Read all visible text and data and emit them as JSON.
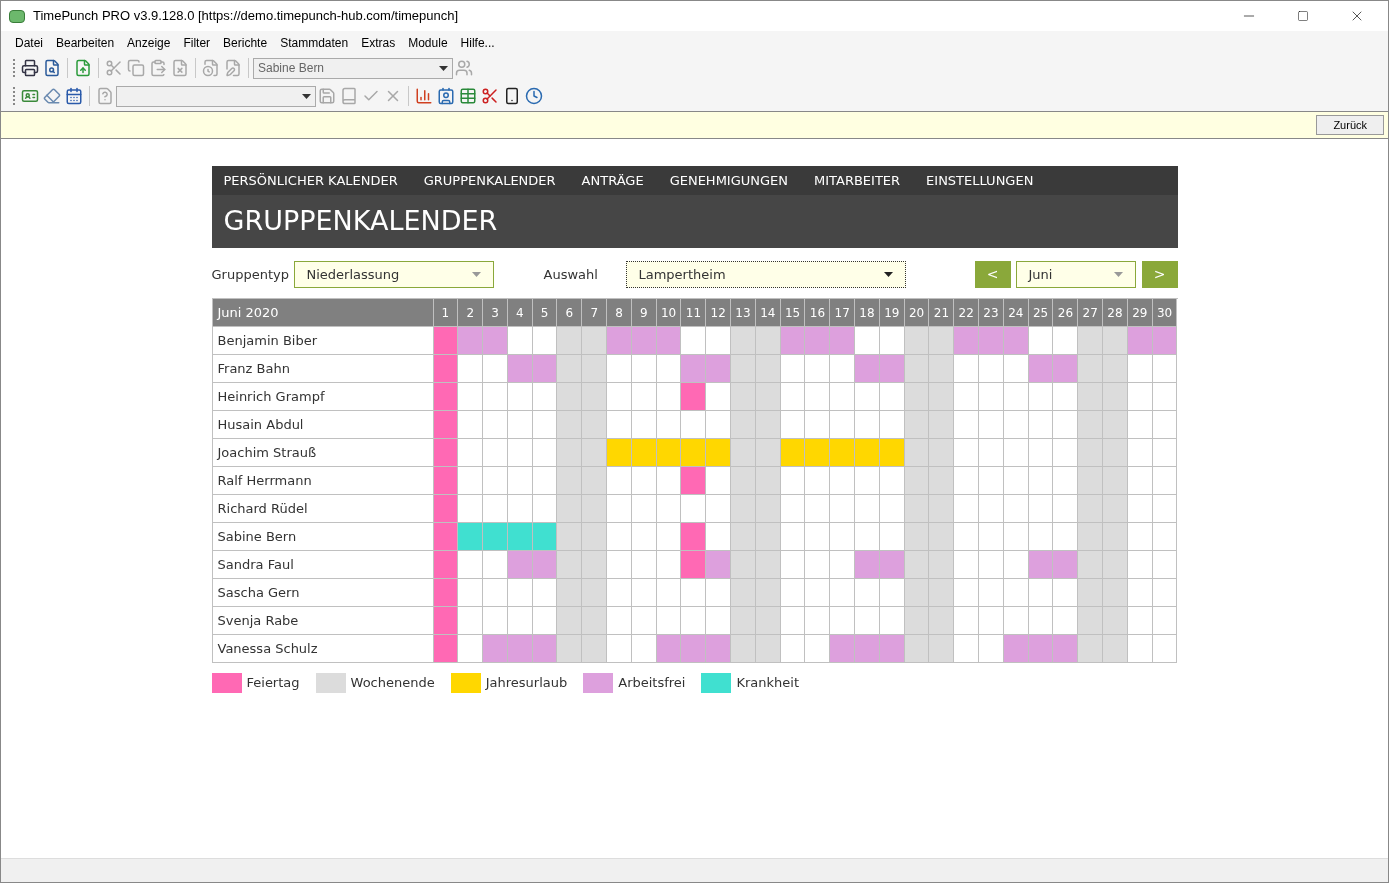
{
  "window": {
    "title": "TimePunch PRO v3.9.128.0 [https://demo.timepunch-hub.com/timepunch]"
  },
  "menu": [
    "Datei",
    "Bearbeiten",
    "Anzeige",
    "Filter",
    "Berichte",
    "Stammdaten",
    "Extras",
    "Module",
    "Hilfe..."
  ],
  "toolbar": {
    "user_select": "Sabine Bern"
  },
  "info_bar": {
    "back_button": "Zurück"
  },
  "nav": [
    "PERSÖNLICHER KALENDER",
    "GRUPPENKALENDER",
    "ANTRÄGE",
    "GENEHMIGUNGEN",
    "MITARBEITER",
    "EINSTELLUNGEN"
  ],
  "page_title": "GRUPPENKALENDER",
  "filters": {
    "group_type_label": "Gruppentyp",
    "group_type": "Niederlassung",
    "selection_label": "Auswahl",
    "selection": "Lampertheim",
    "prev": "<",
    "month": "Juni",
    "next": ">"
  },
  "calendar": {
    "month_label": "Juni 2020",
    "days": [
      "1",
      "2",
      "3",
      "4",
      "5",
      "6",
      "7",
      "8",
      "9",
      "10",
      "11",
      "12",
      "13",
      "14",
      "15",
      "16",
      "17",
      "18",
      "19",
      "20",
      "21",
      "22",
      "23",
      "24",
      "25",
      "26",
      "27",
      "28",
      "29",
      "30"
    ],
    "rows": [
      {
        "name": "Benjamin Biber",
        "cells": [
          {
            "kind": "holiday"
          },
          {
            "kind": "dayoff"
          },
          {
            "kind": "dayoff"
          },
          {
            "kind": "none"
          },
          {
            "kind": "none"
          },
          {
            "kind": "weekend"
          },
          {
            "kind": "weekend"
          },
          {
            "kind": "dayoff"
          },
          {
            "kind": "dayoff"
          },
          {
            "kind": "dayoff"
          },
          {
            "kind": "none"
          },
          {
            "kind": "none"
          },
          {
            "kind": "weekend"
          },
          {
            "kind": "weekend"
          },
          {
            "kind": "dayoff"
          },
          {
            "kind": "dayoff"
          },
          {
            "kind": "dayoff"
          },
          {
            "kind": "none"
          },
          {
            "kind": "none"
          },
          {
            "kind": "weekend"
          },
          {
            "kind": "weekend"
          },
          {
            "kind": "dayoff"
          },
          {
            "kind": "dayoff"
          },
          {
            "kind": "dayoff"
          },
          {
            "kind": "none"
          },
          {
            "kind": "none"
          },
          {
            "kind": "weekend"
          },
          {
            "kind": "weekend"
          },
          {
            "kind": "dayoff"
          },
          {
            "kind": "dayoff"
          }
        ]
      },
      {
        "name": "Franz Bahn",
        "cells": [
          {
            "kind": "holiday"
          },
          {
            "kind": "none"
          },
          {
            "kind": "none"
          },
          {
            "kind": "dayoff"
          },
          {
            "kind": "dayoff"
          },
          {
            "kind": "weekend"
          },
          {
            "kind": "weekend"
          },
          {
            "kind": "none"
          },
          {
            "kind": "none"
          },
          {
            "kind": "none"
          },
          {
            "kind": "dayoff"
          },
          {
            "kind": "dayoff"
          },
          {
            "kind": "weekend"
          },
          {
            "kind": "weekend"
          },
          {
            "kind": "none"
          },
          {
            "kind": "none"
          },
          {
            "kind": "none"
          },
          {
            "kind": "dayoff"
          },
          {
            "kind": "dayoff"
          },
          {
            "kind": "weekend"
          },
          {
            "kind": "weekend"
          },
          {
            "kind": "none"
          },
          {
            "kind": "none"
          },
          {
            "kind": "none"
          },
          {
            "kind": "dayoff"
          },
          {
            "kind": "dayoff"
          },
          {
            "kind": "weekend"
          },
          {
            "kind": "weekend"
          },
          {
            "kind": "none"
          },
          {
            "kind": "none"
          }
        ]
      },
      {
        "name": "Heinrich Grampf",
        "cells": [
          {
            "kind": "holiday"
          },
          {
            "kind": "none"
          },
          {
            "kind": "none"
          },
          {
            "kind": "none"
          },
          {
            "kind": "none"
          },
          {
            "kind": "weekend"
          },
          {
            "kind": "weekend"
          },
          {
            "kind": "none"
          },
          {
            "kind": "none"
          },
          {
            "kind": "none"
          },
          {
            "kind": "holiday"
          },
          {
            "kind": "none"
          },
          {
            "kind": "weekend"
          },
          {
            "kind": "weekend"
          },
          {
            "kind": "none"
          },
          {
            "kind": "none"
          },
          {
            "kind": "none"
          },
          {
            "kind": "none"
          },
          {
            "kind": "none"
          },
          {
            "kind": "weekend"
          },
          {
            "kind": "weekend"
          },
          {
            "kind": "none"
          },
          {
            "kind": "none"
          },
          {
            "kind": "none"
          },
          {
            "kind": "none"
          },
          {
            "kind": "none"
          },
          {
            "kind": "weekend"
          },
          {
            "kind": "weekend"
          },
          {
            "kind": "none"
          },
          {
            "kind": "none"
          }
        ]
      },
      {
        "name": "Husain Abdul",
        "cells": [
          {
            "kind": "holiday"
          },
          {
            "kind": "none"
          },
          {
            "kind": "none"
          },
          {
            "kind": "none"
          },
          {
            "kind": "none"
          },
          {
            "kind": "weekend"
          },
          {
            "kind": "weekend"
          },
          {
            "kind": "none"
          },
          {
            "kind": "none"
          },
          {
            "kind": "none"
          },
          {
            "kind": "none"
          },
          {
            "kind": "none"
          },
          {
            "kind": "weekend"
          },
          {
            "kind": "weekend"
          },
          {
            "kind": "none"
          },
          {
            "kind": "none"
          },
          {
            "kind": "none"
          },
          {
            "kind": "none"
          },
          {
            "kind": "none"
          },
          {
            "kind": "weekend"
          },
          {
            "kind": "weekend"
          },
          {
            "kind": "none"
          },
          {
            "kind": "none"
          },
          {
            "kind": "none"
          },
          {
            "kind": "none"
          },
          {
            "kind": "none"
          },
          {
            "kind": "weekend"
          },
          {
            "kind": "weekend"
          },
          {
            "kind": "none"
          },
          {
            "kind": "none"
          }
        ]
      },
      {
        "name": "Joachim Strauß",
        "cells": [
          {
            "kind": "holiday"
          },
          {
            "kind": "none"
          },
          {
            "kind": "none"
          },
          {
            "kind": "none"
          },
          {
            "kind": "none"
          },
          {
            "kind": "weekend"
          },
          {
            "kind": "weekend"
          },
          {
            "kind": "vacation"
          },
          {
            "kind": "vacation"
          },
          {
            "kind": "vacation"
          },
          {
            "kind": "vacation"
          },
          {
            "kind": "vacation"
          },
          {
            "kind": "weekend"
          },
          {
            "kind": "weekend"
          },
          {
            "kind": "vacation"
          },
          {
            "kind": "vacation"
          },
          {
            "kind": "vacation"
          },
          {
            "kind": "vacation"
          },
          {
            "kind": "vacation"
          },
          {
            "kind": "weekend"
          },
          {
            "kind": "weekend"
          },
          {
            "kind": "none"
          },
          {
            "kind": "none"
          },
          {
            "kind": "none"
          },
          {
            "kind": "none"
          },
          {
            "kind": "none"
          },
          {
            "kind": "weekend"
          },
          {
            "kind": "weekend"
          },
          {
            "kind": "none"
          },
          {
            "kind": "none"
          }
        ]
      },
      {
        "name": "Ralf Herrmann",
        "cells": [
          {
            "kind": "holiday"
          },
          {
            "kind": "none"
          },
          {
            "kind": "none"
          },
          {
            "kind": "none"
          },
          {
            "kind": "none"
          },
          {
            "kind": "weekend"
          },
          {
            "kind": "weekend"
          },
          {
            "kind": "none"
          },
          {
            "kind": "none"
          },
          {
            "kind": "none"
          },
          {
            "kind": "holiday"
          },
          {
            "kind": "none"
          },
          {
            "kind": "weekend"
          },
          {
            "kind": "weekend"
          },
          {
            "kind": "none"
          },
          {
            "kind": "none"
          },
          {
            "kind": "none"
          },
          {
            "kind": "none"
          },
          {
            "kind": "none"
          },
          {
            "kind": "weekend"
          },
          {
            "kind": "weekend"
          },
          {
            "kind": "none"
          },
          {
            "kind": "none"
          },
          {
            "kind": "none"
          },
          {
            "kind": "none"
          },
          {
            "kind": "none"
          },
          {
            "kind": "weekend"
          },
          {
            "kind": "weekend"
          },
          {
            "kind": "none"
          },
          {
            "kind": "none"
          }
        ]
      },
      {
        "name": "Richard Rüdel",
        "cells": [
          {
            "kind": "holiday"
          },
          {
            "kind": "none"
          },
          {
            "kind": "none"
          },
          {
            "kind": "none"
          },
          {
            "kind": "none"
          },
          {
            "kind": "weekend"
          },
          {
            "kind": "weekend"
          },
          {
            "kind": "none"
          },
          {
            "kind": "none"
          },
          {
            "kind": "none"
          },
          {
            "kind": "none"
          },
          {
            "kind": "none"
          },
          {
            "kind": "weekend"
          },
          {
            "kind": "weekend"
          },
          {
            "kind": "none"
          },
          {
            "kind": "none"
          },
          {
            "kind": "none"
          },
          {
            "kind": "none"
          },
          {
            "kind": "none"
          },
          {
            "kind": "weekend"
          },
          {
            "kind": "weekend"
          },
          {
            "kind": "none"
          },
          {
            "kind": "none"
          },
          {
            "kind": "none"
          },
          {
            "kind": "none"
          },
          {
            "kind": "none"
          },
          {
            "kind": "weekend"
          },
          {
            "kind": "weekend"
          },
          {
            "kind": "none"
          },
          {
            "kind": "none"
          }
        ]
      },
      {
        "name": "Sabine Bern",
        "cells": [
          {
            "kind": "holiday"
          },
          {
            "kind": "sick"
          },
          {
            "kind": "sick"
          },
          {
            "kind": "sick"
          },
          {
            "kind": "sick"
          },
          {
            "kind": "weekend"
          },
          {
            "kind": "weekend"
          },
          {
            "kind": "none"
          },
          {
            "kind": "none"
          },
          {
            "kind": "none"
          },
          {
            "kind": "holiday"
          },
          {
            "kind": "none"
          },
          {
            "kind": "weekend"
          },
          {
            "kind": "weekend"
          },
          {
            "kind": "none"
          },
          {
            "kind": "none"
          },
          {
            "kind": "none"
          },
          {
            "kind": "none"
          },
          {
            "kind": "none"
          },
          {
            "kind": "weekend"
          },
          {
            "kind": "weekend"
          },
          {
            "kind": "none"
          },
          {
            "kind": "none"
          },
          {
            "kind": "none"
          },
          {
            "kind": "none"
          },
          {
            "kind": "none"
          },
          {
            "kind": "weekend"
          },
          {
            "kind": "weekend"
          },
          {
            "kind": "none"
          },
          {
            "kind": "none"
          }
        ]
      },
      {
        "name": "Sandra Faul",
        "cells": [
          {
            "kind": "holiday"
          },
          {
            "kind": "none"
          },
          {
            "kind": "none"
          },
          {
            "kind": "dayoff"
          },
          {
            "kind": "dayoff"
          },
          {
            "kind": "weekend"
          },
          {
            "kind": "weekend"
          },
          {
            "kind": "none"
          },
          {
            "kind": "none"
          },
          {
            "kind": "none"
          },
          {
            "kind": "holiday"
          },
          {
            "kind": "dayoff"
          },
          {
            "kind": "weekend"
          },
          {
            "kind": "weekend"
          },
          {
            "kind": "none"
          },
          {
            "kind": "none"
          },
          {
            "kind": "none"
          },
          {
            "kind": "dayoff"
          },
          {
            "kind": "dayoff"
          },
          {
            "kind": "weekend"
          },
          {
            "kind": "weekend"
          },
          {
            "kind": "none"
          },
          {
            "kind": "none"
          },
          {
            "kind": "none"
          },
          {
            "kind": "dayoff"
          },
          {
            "kind": "dayoff"
          },
          {
            "kind": "weekend"
          },
          {
            "kind": "weekend"
          },
          {
            "kind": "none"
          },
          {
            "kind": "none"
          }
        ]
      },
      {
        "name": "Sascha Gern",
        "cells": [
          {
            "kind": "holiday"
          },
          {
            "kind": "none"
          },
          {
            "kind": "none"
          },
          {
            "kind": "none"
          },
          {
            "kind": "none"
          },
          {
            "kind": "weekend"
          },
          {
            "kind": "weekend"
          },
          {
            "kind": "none"
          },
          {
            "kind": "none"
          },
          {
            "kind": "none"
          },
          {
            "kind": "none"
          },
          {
            "kind": "none"
          },
          {
            "kind": "weekend"
          },
          {
            "kind": "weekend"
          },
          {
            "kind": "none"
          },
          {
            "kind": "none"
          },
          {
            "kind": "none"
          },
          {
            "kind": "none"
          },
          {
            "kind": "none"
          },
          {
            "kind": "weekend"
          },
          {
            "kind": "weekend"
          },
          {
            "kind": "none"
          },
          {
            "kind": "none"
          },
          {
            "kind": "none"
          },
          {
            "kind": "none"
          },
          {
            "kind": "none"
          },
          {
            "kind": "weekend"
          },
          {
            "kind": "weekend"
          },
          {
            "kind": "none"
          },
          {
            "kind": "none"
          }
        ]
      },
      {
        "name": "Svenja Rabe",
        "cells": [
          {
            "kind": "holiday"
          },
          {
            "kind": "none"
          },
          {
            "kind": "none"
          },
          {
            "kind": "none"
          },
          {
            "kind": "none"
          },
          {
            "kind": "weekend"
          },
          {
            "kind": "weekend"
          },
          {
            "kind": "none"
          },
          {
            "kind": "none"
          },
          {
            "kind": "none"
          },
          {
            "kind": "none"
          },
          {
            "kind": "none"
          },
          {
            "kind": "weekend"
          },
          {
            "kind": "weekend"
          },
          {
            "kind": "none"
          },
          {
            "kind": "none"
          },
          {
            "kind": "none"
          },
          {
            "kind": "none"
          },
          {
            "kind": "none"
          },
          {
            "kind": "weekend"
          },
          {
            "kind": "weekend"
          },
          {
            "kind": "none"
          },
          {
            "kind": "none"
          },
          {
            "kind": "none"
          },
          {
            "kind": "none"
          },
          {
            "kind": "none"
          },
          {
            "kind": "weekend"
          },
          {
            "kind": "weekend"
          },
          {
            "kind": "none"
          },
          {
            "kind": "none"
          }
        ]
      },
      {
        "name": "Vanessa Schulz",
        "cells": [
          {
            "kind": "holiday"
          },
          {
            "kind": "none"
          },
          {
            "kind": "dayoff"
          },
          {
            "kind": "dayoff"
          },
          {
            "kind": "dayoff"
          },
          {
            "kind": "weekend"
          },
          {
            "kind": "weekend"
          },
          {
            "kind": "none"
          },
          {
            "kind": "none"
          },
          {
            "kind": "dayoff"
          },
          {
            "kind": "dayoff"
          },
          {
            "kind": "dayoff"
          },
          {
            "kind": "weekend"
          },
          {
            "kind": "weekend"
          },
          {
            "kind": "none"
          },
          {
            "kind": "none"
          },
          {
            "kind": "dayoff"
          },
          {
            "kind": "dayoff"
          },
          {
            "kind": "dayoff"
          },
          {
            "kind": "weekend"
          },
          {
            "kind": "weekend"
          },
          {
            "kind": "none"
          },
          {
            "kind": "none"
          },
          {
            "kind": "dayoff"
          },
          {
            "kind": "dayoff"
          },
          {
            "kind": "dayoff"
          },
          {
            "kind": "weekend"
          },
          {
            "kind": "weekend"
          },
          {
            "kind": "none"
          },
          {
            "kind": "none"
          }
        ]
      }
    ]
  },
  "legend": [
    {
      "kind": "holiday",
      "label": "Feiertag",
      "color": "#ff69b4"
    },
    {
      "kind": "weekend",
      "label": "Wochenende",
      "color": "#dcdcdc"
    },
    {
      "kind": "vacation",
      "label": "Jahresurlaub",
      "color": "#ffd700"
    },
    {
      "kind": "dayoff",
      "label": "Arbeitsfrei",
      "color": "#dda0dd"
    },
    {
      "kind": "sick",
      "label": "Krankheit",
      "color": "#40e0d0"
    }
  ]
}
